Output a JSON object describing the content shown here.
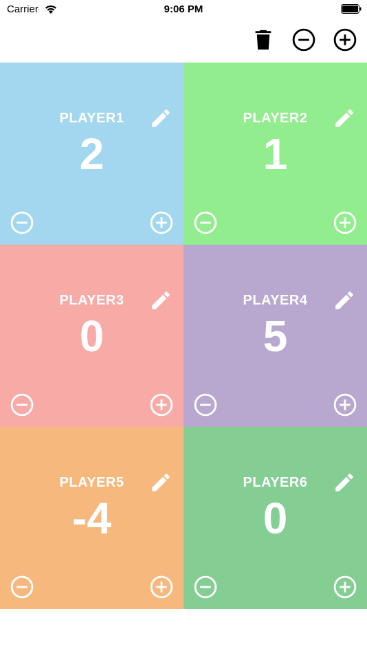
{
  "status_bar": {
    "carrier": "Carrier",
    "time": "9:06 PM"
  },
  "toolbar": {
    "icons": [
      "trash-icon",
      "minus-circle-icon",
      "plus-circle-icon"
    ]
  },
  "colors": {
    "tile_blue": "#a3d7ef",
    "tile_green": "#92ed8f",
    "tile_red": "#f7aaa6",
    "tile_purple": "#b8a8cf",
    "tile_orange": "#f7b87e",
    "tile_dark_green": "#84cd93"
  },
  "players": [
    {
      "name": "PLAYER1",
      "score": "2"
    },
    {
      "name": "PLAYER2",
      "score": "1"
    },
    {
      "name": "PLAYER3",
      "score": "0"
    },
    {
      "name": "PLAYER4",
      "score": "5"
    },
    {
      "name": "PLAYER5",
      "score": "-4"
    },
    {
      "name": "PLAYER6",
      "score": "0"
    }
  ]
}
